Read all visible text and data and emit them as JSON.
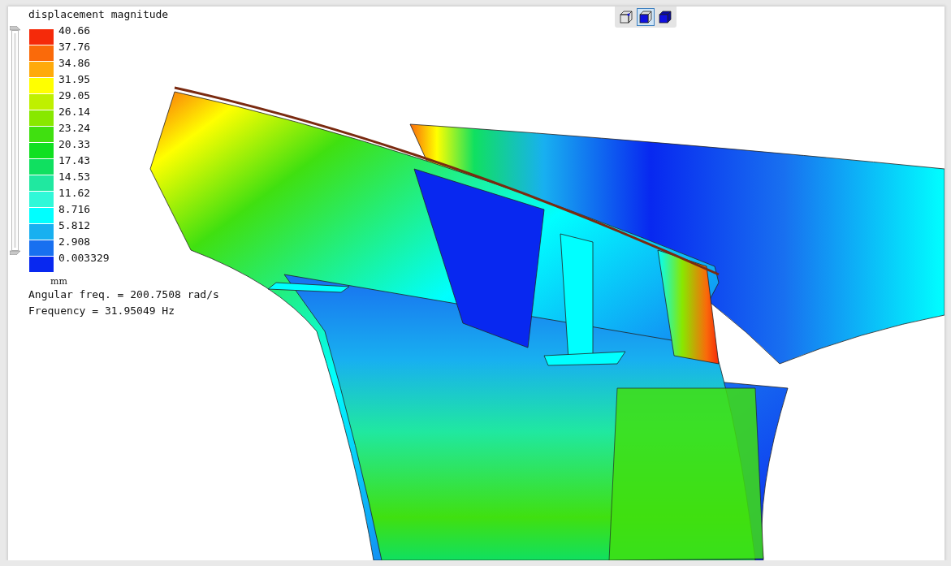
{
  "legend": {
    "title": "displacement magnitude",
    "bands": [
      {
        "color": "#f52a0a"
      },
      {
        "color": "#fa6a0a"
      },
      {
        "color": "#ffaa0a"
      },
      {
        "color": "#ffff00"
      },
      {
        "color": "#bff000"
      },
      {
        "color": "#88e800"
      },
      {
        "color": "#40e010"
      },
      {
        "color": "#10e020"
      },
      {
        "color": "#10e060"
      },
      {
        "color": "#20e8a0"
      },
      {
        "color": "#30f8d8"
      },
      {
        "color": "#00ffff"
      },
      {
        "color": "#18b0f0"
      },
      {
        "color": "#1870f0"
      },
      {
        "color": "#0828f0"
      }
    ],
    "values": [
      "40.66",
      "37.76",
      "34.86",
      "31.95",
      "29.05",
      "26.14",
      "23.24",
      "20.33",
      "17.43",
      "14.53",
      "11.62",
      "8.716",
      "5.812",
      "2.908",
      "0.003329"
    ],
    "unit": "mm",
    "range": {
      "level": 1
    }
  },
  "info": [
    "Angular freq. = 200.7508 rad/s",
    "Frequency = 31.95049 Hz"
  ],
  "view_buttons": [
    {
      "kind": "wireframe",
      "selected": false
    },
    {
      "kind": "shaded-edges",
      "selected": true
    },
    {
      "kind": "shaded",
      "selected": false
    }
  ]
}
